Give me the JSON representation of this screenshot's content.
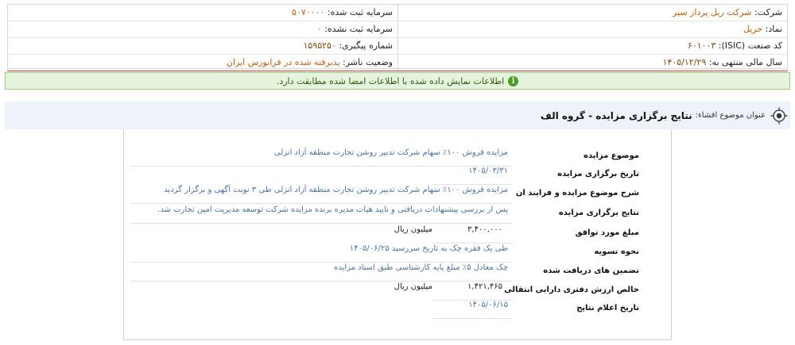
{
  "header": {
    "company_label": "شرکت:",
    "company_value": "شرکت ریل پرداز سیر",
    "symbol_label": "نماد:",
    "symbol_value": "حریل",
    "isic_label": "کد صنعت (ISIC):",
    "isic_value": "۶۰۱۰۰۳",
    "fiscal_label": "سال مالی منتهی به:",
    "fiscal_value": "۱۴۰۵/۱۲/۲۹",
    "registered_capital_label": "سرمایه ثبت شده:",
    "registered_capital_value": "۵۰۷۰۰۰۰",
    "unregistered_capital_label": "سرمایه ثبت نشده:",
    "unregistered_capital_value": "۰",
    "tracking_label": "شماره پیگیری:",
    "tracking_value": "۱۵۹۵۲۵۰",
    "publisher_status_label": "وضعیت ناشر:",
    "publisher_status_value": "پذیرفته شده در فرابورس ایران"
  },
  "banner": {
    "text": "اطلاعات نمایش داده شده با اطلاعات امضا شده مطابقت دارد.",
    "icon": "info-icon",
    "bg_color": "#e6f3dd"
  },
  "title_bar": {
    "label": "عنوان موضوع افشاء:",
    "value": "نتایج برگزاری مزایده - گروه الف",
    "icon": "target-icon"
  },
  "details": [
    {
      "label": "موضوع مزایده",
      "value": "مزایده فروش ۱۰۰٪ سهام شرکت تدبیر روشن تجارت منطقه آزاد انزلی",
      "unit": ""
    },
    {
      "label": "تاریخ برگزاری مزایده",
      "value": "۱۴۰۵/۰۳/۳۱",
      "unit": ""
    },
    {
      "label": "شرح موضوع مزایده و فرایند ان",
      "value": "مزایده فروش ۱۰۰٪ سهام شرکت تدبیر روشن تجارت منطقه آزاد انزلی طی ۳ نوبت آگهی و برگزار گردید",
      "unit": ""
    },
    {
      "label": "نتایج برگزاری مزایده",
      "value": "پس از بررسی پیشنهادات دریافتی و تایید هیات مدیره برنده مزایده شرکت توسعه مدیریت امین تجارت شد.",
      "unit": ""
    },
    {
      "label": "مبلغ مورد توافق",
      "value": "۳,۴۰۰,۰۰۰",
      "unit": "میلیون ریال"
    },
    {
      "label": "نحوه تسویه",
      "value": "طی یک فقره چک به تاریخ سررسید ۱۴۰۵/۰۶/۲۵",
      "unit": ""
    },
    {
      "label": "تضمین های دریافت شده",
      "value": "چک معادل ۵٪ مبلغ پایه کارشناسی طبق اسناد مزایده",
      "unit": ""
    },
    {
      "label": "خالص ارزش دفتری دارایی انتقالی",
      "value": "۱,۴۲۱,۴۶۵",
      "unit": "میلیون ریال"
    },
    {
      "label": "تاریخ اعلام نتایج",
      "value": "۱۴۰۵/۰۶/۱۵",
      "unit": ""
    }
  ]
}
